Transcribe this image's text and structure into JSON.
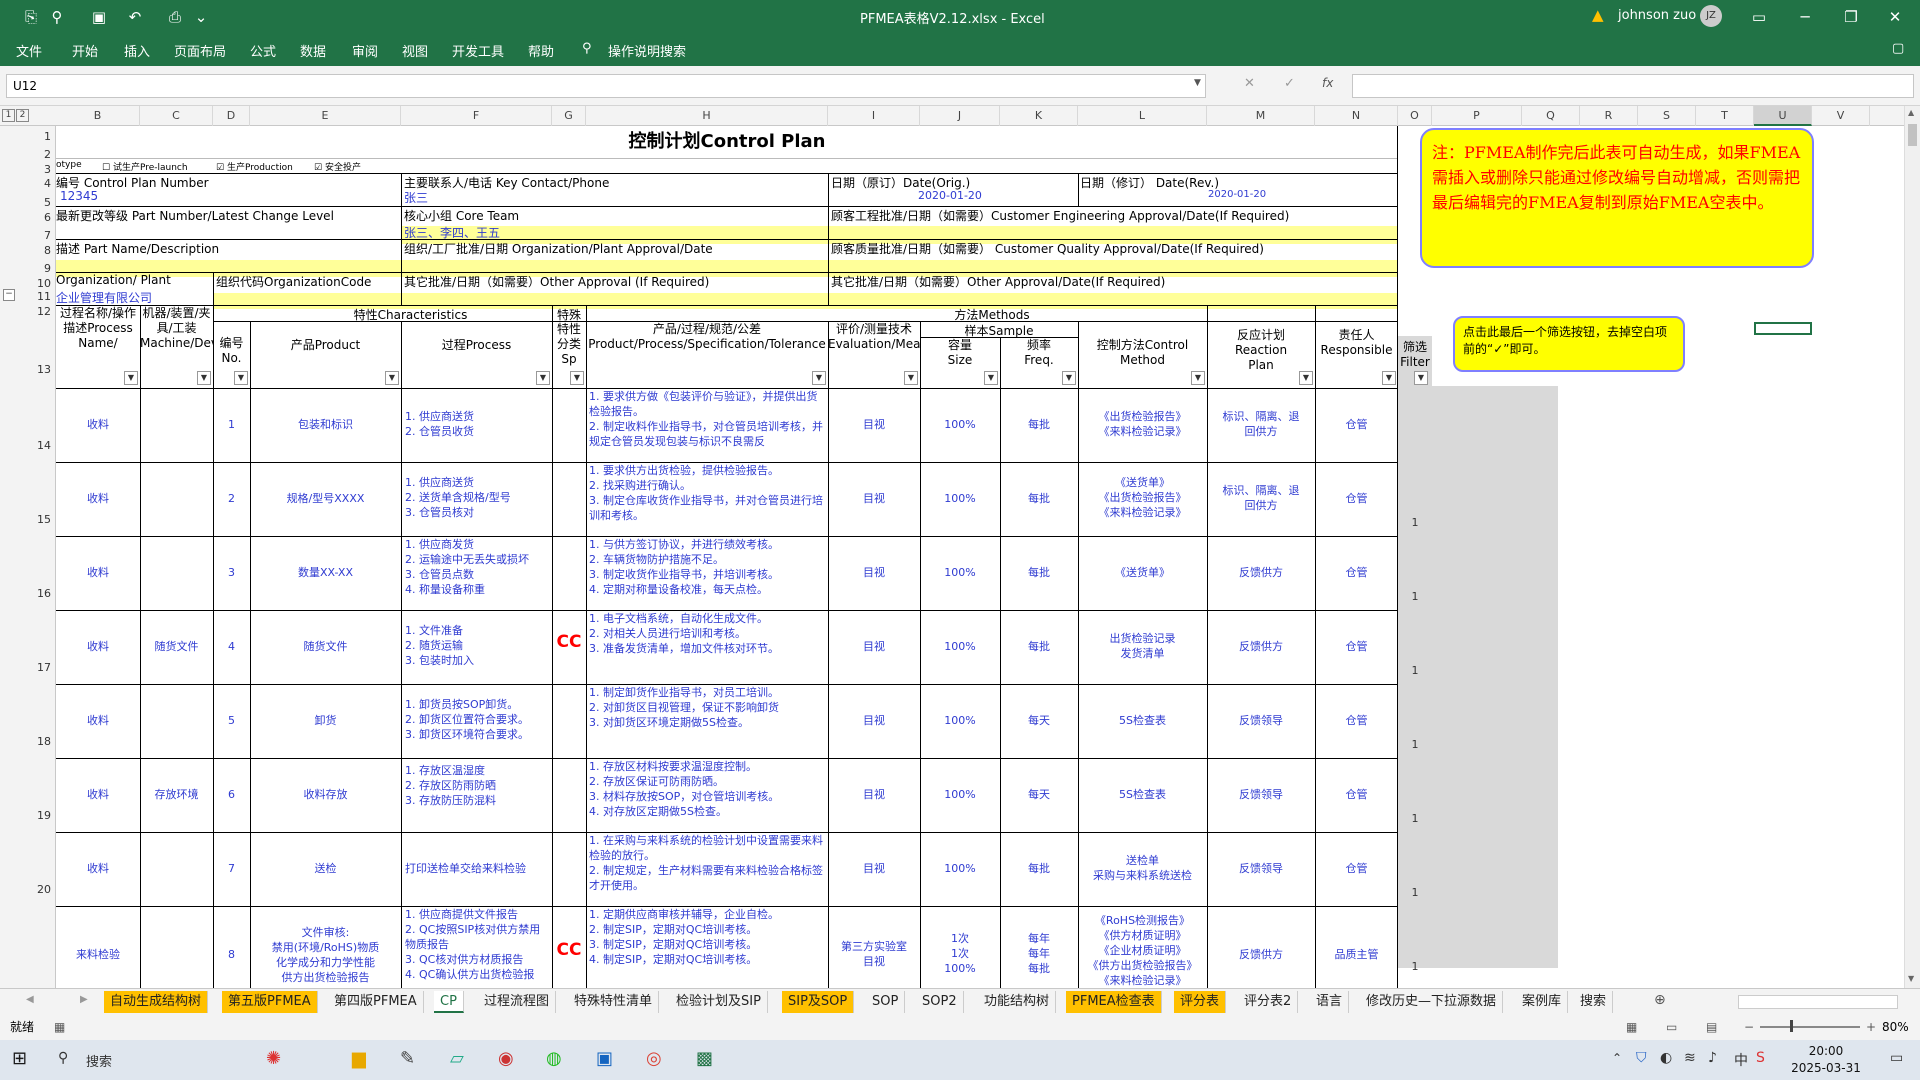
{
  "window": {
    "title": "PFMEA表格V2.12.xlsx  -  Excel",
    "user": "johnson zuo",
    "user_initials": "JZ"
  },
  "ribbon": {
    "tabs": [
      "文件",
      "开始",
      "插入",
      "页面布局",
      "公式",
      "数据",
      "审阅",
      "视图",
      "开发工具",
      "帮助",
      "操作说明搜索"
    ]
  },
  "formula": {
    "cell_ref": "U12",
    "fx": "fx"
  },
  "columns": [
    "B",
    "C",
    "D",
    "E",
    "F",
    "G",
    "H",
    "I",
    "J",
    "K",
    "L",
    "M",
    "N",
    "O",
    "P",
    "Q",
    "R",
    "S",
    "T",
    "U",
    "V"
  ],
  "rows": [
    "1",
    "2",
    "3",
    "4",
    "5",
    "6",
    "7",
    "8",
    "9",
    "10",
    "11",
    "12",
    "13",
    "14",
    "15",
    "16",
    "17",
    "18",
    "19",
    "20"
  ],
  "outline": [
    "1",
    "2"
  ],
  "sheet": {
    "title": "控制计划Control Plan",
    "r2": {
      "a": "otype",
      "b": "试生产Pre-launch",
      "c": "生产Production",
      "d": "安全投产"
    },
    "r3": {
      "a": "编号 Control Plan Number",
      "b": "主要联系人/电话 Key Contact/Phone",
      "c": "日期（原订）Date(Orig.)",
      "d": "日期（修订） Date(Rev.)"
    },
    "r4": {
      "a": "12345",
      "b": "张三",
      "c": "2020-01-20",
      "d": "2020-01-20"
    },
    "r5": {
      "a": "最新更改等级 Part Number/Latest Change Level",
      "b": "核心小组 Core Team",
      "c": "顾客工程批准/日期（如需要）Customer Engineering Approval/Date(If Required)"
    },
    "r6": {
      "b": "张三、李四、王五"
    },
    "r7": {
      "a": "描述 Part Name/Description",
      "b": "组织/工厂批准/日期 Organization/Plant Approval/Date",
      "c": "顾客质量批准/日期（如需要） Customer Quality Approval/Date(If Required)"
    },
    "r9": {
      "a": "Organization/ Plant",
      "b": "组织代码OrganizationCode",
      "c": "其它批准/日期（如需要）Other Approval (If Required)",
      "d": "其它批准/日期（如需要）Other Approval/Date(If Required)"
    },
    "r10": {
      "a": "企业管理有限公司"
    },
    "groups": {
      "char": "特性Characteristics",
      "special": "特殊",
      "methods": "方法Methods",
      "sample": "样本Sample"
    },
    "headers": {
      "process": "过程名称/操作描述Process Name/",
      "machine": "机器/装置/夹具/工装Machine/Device/Jig",
      "no": "编号No.",
      "product": "产品Product",
      "proc": "过程Process",
      "spc": "特性分类Sp",
      "spec": "产品/过程/规范/公差Product/Process/Specification/Tolerance",
      "eval": "评价/测量技术Evaluation/Measuremen",
      "size": "容量Size",
      "freq": "频率Freq.",
      "control": "控制方法Control Method",
      "reaction": "反应计划Reaction Plan",
      "resp": "责任人Responsible",
      "filter": "筛选Filter"
    },
    "data": [
      {
        "name": "收料",
        "machine": "",
        "no": "1",
        "product": "包装和标识",
        "process": "1. 供应商送货\n2. 仓管员收货",
        "spc": "",
        "spec": "1. 要求供方做《包装评价与验证》，并提供出货检验报告。\n2. 制定收料作业指导书，对仓管员培训考核，并规定仓管员发现包装与标识不良需反",
        "eval": "目视",
        "size": "100%",
        "freq": "每批",
        "control": "《出货检验报告》\n《来料检验记录》",
        "reaction": "标识、隔离、退回供方",
        "resp": "仓管",
        "filter": "1"
      },
      {
        "name": "收料",
        "machine": "",
        "no": "2",
        "product": "规格/型号XXXX",
        "process": "1. 供应商送货\n2. 送货单含规格/型号\n3. 仓管员核对",
        "spc": "",
        "spec": "1. 要求供方出货检验，提供检验报告。\n2. 找采购进行确认。\n3. 制定仓库收货作业指导书，并对仓管员进行培训和考核。",
        "eval": "目视",
        "size": "100%",
        "freq": "每批",
        "control": "《送货单》\n《出货检验报告》\n《来料检验记录》",
        "reaction": "标识、隔离、退回供方",
        "resp": "仓管",
        "filter": "1"
      },
      {
        "name": "收料",
        "machine": "",
        "no": "3",
        "product": "数量XX-XX",
        "process": "1. 供应商发货\n2. 运输途中无丢失或损坏\n3. 仓管员点数\n4. 称量设备称重",
        "spc": "",
        "spec": "1. 与供方签订协议，并进行绩效考核。\n2. 车辆货物防护措施不足。\n3. 制定收货作业指导书，并培训考核。\n4. 定期对称量设备校准，每天点检。",
        "eval": "目视",
        "size": "100%",
        "freq": "每批",
        "control": "《送货单》",
        "reaction": "反馈供方",
        "resp": "仓管",
        "filter": "1"
      },
      {
        "name": "收料",
        "machine": "随货文件",
        "no": "4",
        "product": "随货文件",
        "process": "1. 文件准备\n2. 随货运输\n3. 包装时加入",
        "spc": "CC",
        "spec": "1. 电子文档系统，自动化生成文件。\n2. 对相关人员进行培训和考核。\n3. 准备发货清单，增加文件核对环节。",
        "eval": "目视",
        "size": "100%",
        "freq": "每批",
        "control": "出货检验记录\n发货清单",
        "reaction": "反馈供方",
        "resp": "仓管",
        "filter": "1"
      },
      {
        "name": "收料",
        "machine": "",
        "no": "5",
        "product": "卸货",
        "process": "1. 卸货员按SOP卸货。\n2. 卸货区位置符合要求。\n3. 卸货区环境符合要求。",
        "spc": "",
        "spec": "1. 制定卸货作业指导书，对员工培训。\n2. 对卸货区目视管理，保证不影响卸货\n3. 对卸货区环境定期做5S检查。",
        "eval": "目视",
        "size": "100%",
        "freq": "每天",
        "control": "5S检查表",
        "reaction": "反馈领导",
        "resp": "仓管",
        "filter": "1"
      },
      {
        "name": "收料",
        "machine": "存放环境",
        "no": "6",
        "product": "收料存放",
        "process": "1. 存放区温湿度\n2. 存放区防雨防晒\n3. 存放防压防混料",
        "spc": "",
        "spec": "1. 存放区材料按要求温湿度控制。\n2. 存放区保证可防雨防晒。\n3. 材料存放按SOP，对仓管培训考核。\n4. 对存放区定期做5S检查。",
        "eval": "目视",
        "size": "100%",
        "freq": "每天",
        "control": "5S检查表",
        "reaction": "反馈领导",
        "resp": "仓管",
        "filter": "1"
      },
      {
        "name": "收料",
        "machine": "",
        "no": "7",
        "product": "送检",
        "process": "打印送检单交给来料检验",
        "spc": "",
        "spec": "1. 在采购与来料系统的检验计划中设置需要来料检验的放行。\n2. 制定规定，生产材料需要有来料检验合格标签才开使用。",
        "eval": "目视",
        "size": "100%",
        "freq": "每批",
        "control": "送检单\n采购与来料系统送检",
        "reaction": "反馈领导",
        "resp": "仓管",
        "filter": "1"
      },
      {
        "name": "来料检验",
        "machine": "",
        "no": "8",
        "product": "文件审核:\n禁用(环境/RoHS)物质\n化学成分和力学性能\n供方出货检验报告",
        "process": "1. 供应商提供文件报告\n2. QC按照SIP核对供方禁用物质报告\n3. QC核对供方材质报告\n4. QC确认供方出货检验报",
        "spc": "CC",
        "spec": "1. 定期供应商审核并辅导，企业自检。\n2. 制定SIP，定期对QC培训考核。\n3. 制定SIP，定期对QC培训考核。\n4. 制定SIP，定期对QC培训考核。",
        "eval": "第三方实验室\n目视",
        "size": "1次\n1次\n100%",
        "freq": "每年\n每年\n每批",
        "control": "《RoHS检测报告》\n《供方材质证明》\n《企业材质证明》\n《供方出货检验报告》\n《来料检验记录》",
        "reaction": "反馈供方",
        "resp": "品质主管",
        "filter": ""
      }
    ]
  },
  "notes": {
    "note1": "注：PFMEA制作完后此表可自动生成，如果FMEA需插入或删除只能通过修改编号自动增减，否则需把最后编辑完的FMEA复制到原始FMEA空表中。",
    "note2": "点击此最后一个筛选按钮，去掉空白项前的“✓”即可。"
  },
  "tabs": [
    "自动生成结构树",
    "第五版PFMEA",
    "第四版PFMEA",
    "CP",
    "过程流程图",
    "特殊特性清单",
    "检验计划及SIP",
    "SIP及SOP",
    "SOP",
    "SOP2",
    "功能结构树",
    "PFMEA检查表",
    "评分表",
    "评分表2",
    "语言",
    "修改历史—下拉源数据",
    "案例库",
    "搜索"
  ],
  "status": {
    "ready": "就绪",
    "zoom": "80%"
  },
  "taskbar": {
    "search": "搜索",
    "time": "20:00",
    "date": "2025-03-31",
    "ime": "中"
  }
}
